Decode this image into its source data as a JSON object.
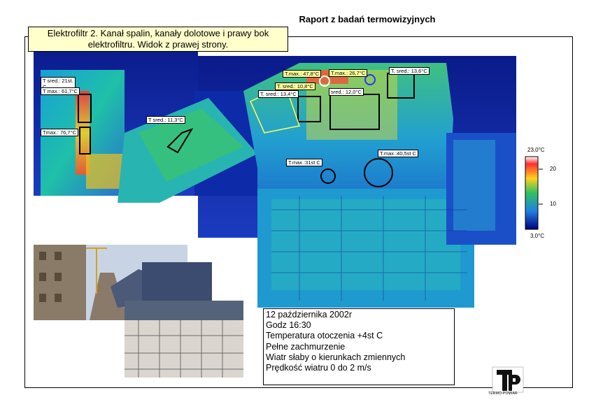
{
  "report": {
    "title": "Raport z badań termowizyjnych",
    "caption": "Elektrofiltr 2. Kanał spalin, kanały dolotowe i prawy bok elektrofiltru. Widok z prawej strony."
  },
  "thermogram": {
    "labels": [
      {
        "id": "sred-21",
        "text": "T sred.: 21st. C"
      },
      {
        "id": "max-617",
        "text": "T max.: 61,7°C"
      },
      {
        "id": "max-767",
        "text": "Tmax.: 76,7°C"
      },
      {
        "id": "sred-113",
        "text": "T sred.: 11,3°C"
      },
      {
        "id": "max-478",
        "text": "T.max.: 47,8°C"
      },
      {
        "id": "max-267",
        "text": "T.max.: 26,7°C"
      },
      {
        "id": "sred-136",
        "text": "T. sred.: 13,6°C"
      },
      {
        "id": "sred-108",
        "text": "T. sred.: 10,8°C"
      },
      {
        "id": "sred-134",
        "text": "T. sred.: 13,4°C"
      },
      {
        "id": "sred-120",
        "text": "sred.: 12,0°C"
      },
      {
        "id": "max-31",
        "text": "T.max.:31st C"
      },
      {
        "id": "max-405",
        "text": "T.max.:40,5st C"
      }
    ],
    "scale": {
      "max": "23,0°C",
      "min": "3,0°C",
      "ticks": [
        "20",
        "10"
      ]
    }
  },
  "conditions": {
    "date": "12 października 2002r",
    "time": "Godz 16:30",
    "temperature": "Temperatura otoczenia +4st C",
    "sky": "Pełne zachmurzenie",
    "wind": "Wiatr słaby o kierunkach zmiennych",
    "wind_speed": "Prędkość wiatru 0 do 2 m/s"
  },
  "logo": {
    "text": "TERMO-POMIAR",
    "letters": "TP"
  }
}
